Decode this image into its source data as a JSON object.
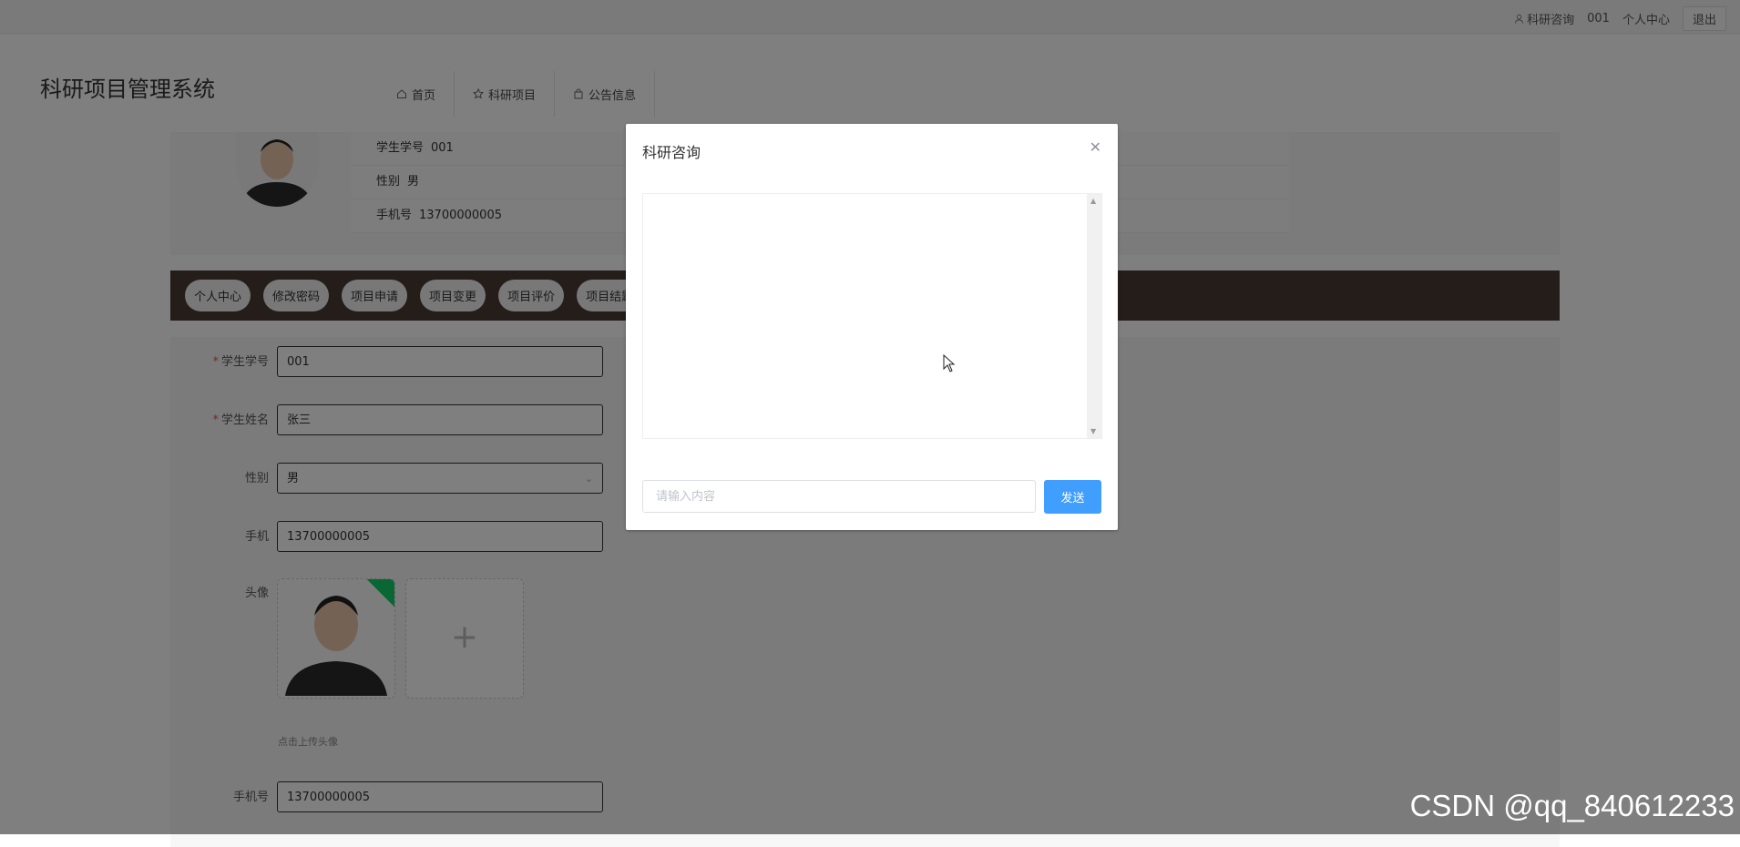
{
  "topbar": {
    "consult_link": "科研咨询",
    "username": "001",
    "personal_center": "个人中心",
    "logout": "退出"
  },
  "header": {
    "logo_title": "科研项目管理系统",
    "nav": [
      {
        "label": "首页",
        "icon": "home-icon"
      },
      {
        "label": "科研项目",
        "icon": "star-icon"
      },
      {
        "label": "公告信息",
        "icon": "bag-icon"
      }
    ]
  },
  "profile": {
    "rows": [
      {
        "key": "学生学号",
        "value": "001"
      },
      {
        "key": "性别",
        "value": "男"
      },
      {
        "key": "手机号",
        "value": "13700000005"
      }
    ]
  },
  "tabs": [
    "个人中心",
    "修改密码",
    "项目申请",
    "项目变更",
    "项目评价",
    "项目结题"
  ],
  "form": {
    "student_id_label": "学生学号",
    "student_id_value": "001",
    "student_name_label": "学生姓名",
    "student_name_value": "张三",
    "gender_label": "性别",
    "gender_value": "男",
    "phone_label": "手机",
    "phone_value": "13700000005",
    "avatar_label": "头像",
    "upload_hint": "点击上传头像",
    "mobile_label": "手机号",
    "mobile_value": "13700000005"
  },
  "dialog": {
    "title": "科研咨询",
    "input_placeholder": "请输入内容",
    "send_label": "发送"
  },
  "watermark": "CSDN @qq_840612233",
  "colors": {
    "tabbar_bg": "#4a3b35",
    "primary": "#409eff",
    "required": "#ee5544",
    "success": "#13ce66"
  }
}
